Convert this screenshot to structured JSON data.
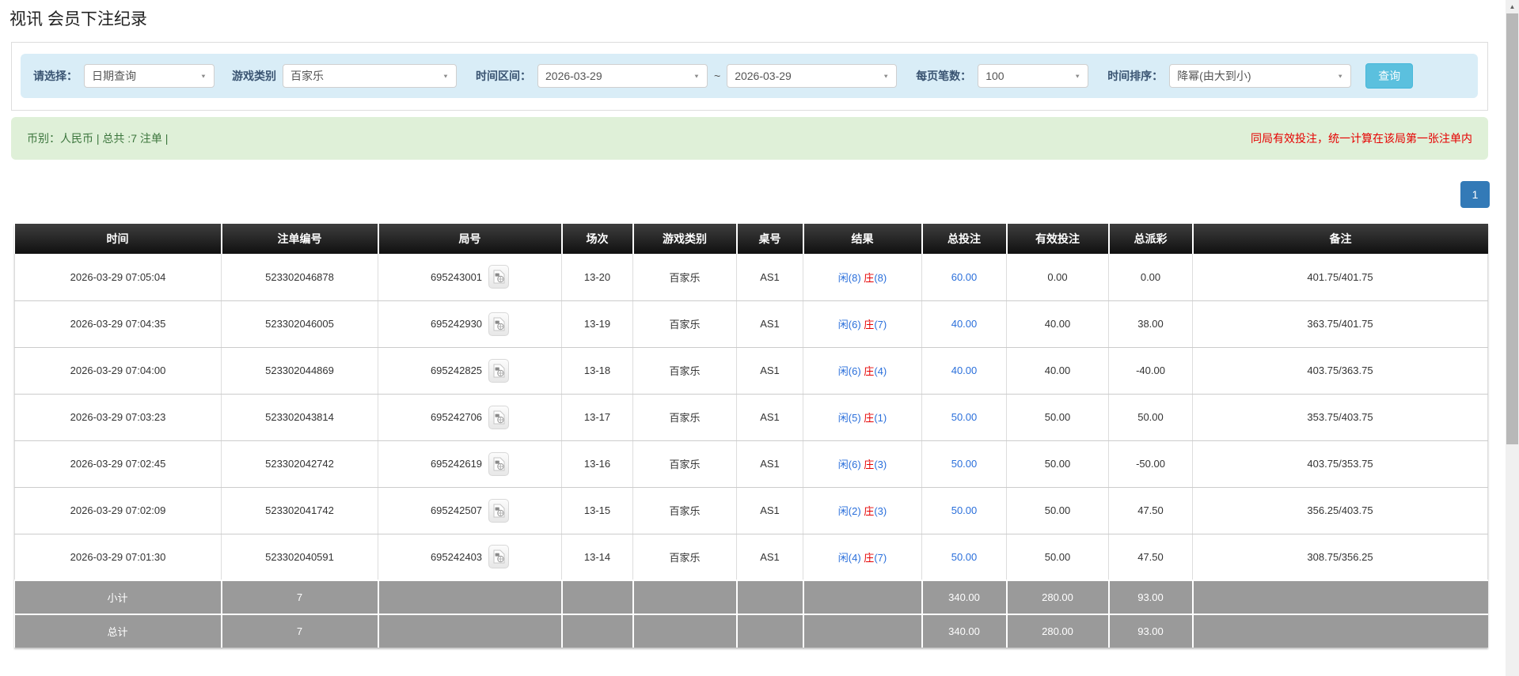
{
  "page": {
    "title": "视讯 会员下注纪录"
  },
  "filters": {
    "select_label": "请选择：",
    "select_value": "日期查询",
    "game_label": "游戏类别",
    "game_value": "百家乐",
    "range_label": "时间区间：",
    "date_from": "2026-03-29",
    "tilde": "~",
    "date_to": "2026-03-29",
    "per_page_label": "每页笔数：",
    "per_page_value": "100",
    "sort_label": "时间排序：",
    "sort_value": "降幂(由大到小)",
    "search_button": "查询"
  },
  "summary": {
    "currency_info": "币别：人民币 | 总共 :7 注单 |",
    "notice": "同局有效投注，统一计算在该局第一张注单内"
  },
  "pagination": {
    "page": "1"
  },
  "icons": {
    "chevron_down": "▼",
    "chevron_up": "▲"
  },
  "colors": {
    "link_blue": "#2a6fdb",
    "negative_red": "#e60000",
    "header_dark": "#101010",
    "footer_gray": "#9a9a9a",
    "panel_blue": "#d9edf7",
    "panel_green": "#dff0d8",
    "button_blue": "#5bc0de",
    "page_button_blue": "#337ab7"
  },
  "table": {
    "headers": [
      "时间",
      "注单编号",
      "局号",
      "场次",
      "游戏类别",
      "桌号",
      "结果",
      "总投注",
      "有效投注",
      "总派彩",
      "备注"
    ],
    "rows": [
      {
        "time": "2026-03-29 07:05:04",
        "bet_id": "523302046878",
        "round_no": "695243001",
        "session": "13-20",
        "game": "百家乐",
        "table_no": "AS1",
        "result_xian": "闲(8)",
        "result_zhuang": "庄",
        "result_zhuang_n": "(8)",
        "total_bet": "60.00",
        "valid_bet": "0.00",
        "payout": "0.00",
        "remark": "401.75/401.75"
      },
      {
        "time": "2026-03-29 07:04:35",
        "bet_id": "523302046005",
        "round_no": "695242930",
        "session": "13-19",
        "game": "百家乐",
        "table_no": "AS1",
        "result_xian": "闲(6)",
        "result_zhuang": "庄",
        "result_zhuang_n": "(7)",
        "total_bet": "40.00",
        "valid_bet": "40.00",
        "payout": "38.00",
        "remark": "363.75/401.75"
      },
      {
        "time": "2026-03-29 07:04:00",
        "bet_id": "523302044869",
        "round_no": "695242825",
        "session": "13-18",
        "game": "百家乐",
        "table_no": "AS1",
        "result_xian": "闲(6)",
        "result_zhuang": "庄",
        "result_zhuang_n": "(4)",
        "total_bet": "40.00",
        "valid_bet": "40.00",
        "payout": "-40.00",
        "remark": "403.75/363.75"
      },
      {
        "time": "2026-03-29 07:03:23",
        "bet_id": "523302043814",
        "round_no": "695242706",
        "session": "13-17",
        "game": "百家乐",
        "table_no": "AS1",
        "result_xian": "闲(5)",
        "result_zhuang": "庄",
        "result_zhuang_n": "(1)",
        "total_bet": "50.00",
        "valid_bet": "50.00",
        "payout": "50.00",
        "remark": "353.75/403.75"
      },
      {
        "time": "2026-03-29 07:02:45",
        "bet_id": "523302042742",
        "round_no": "695242619",
        "session": "13-16",
        "game": "百家乐",
        "table_no": "AS1",
        "result_xian": "闲(6)",
        "result_zhuang": "庄",
        "result_zhuang_n": "(3)",
        "total_bet": "50.00",
        "valid_bet": "50.00",
        "payout": "-50.00",
        "remark": "403.75/353.75"
      },
      {
        "time": "2026-03-29 07:02:09",
        "bet_id": "523302041742",
        "round_no": "695242507",
        "session": "13-15",
        "game": "百家乐",
        "table_no": "AS1",
        "result_xian": "闲(2)",
        "result_zhuang": "庄",
        "result_zhuang_n": "(3)",
        "total_bet": "50.00",
        "valid_bet": "50.00",
        "payout": "47.50",
        "remark": "356.25/403.75"
      },
      {
        "time": "2026-03-29 07:01:30",
        "bet_id": "523302040591",
        "round_no": "695242403",
        "session": "13-14",
        "game": "百家乐",
        "table_no": "AS1",
        "result_xian": "闲(4)",
        "result_zhuang": "庄",
        "result_zhuang_n": "(7)",
        "total_bet": "50.00",
        "valid_bet": "50.00",
        "payout": "47.50",
        "remark": "308.75/356.25"
      }
    ],
    "subtotal": {
      "label": "小计",
      "count": "7",
      "total_bet": "340.00",
      "valid_bet": "280.00",
      "payout": "93.00"
    },
    "total": {
      "label": "总计",
      "count": "7",
      "total_bet": "340.00",
      "valid_bet": "280.00",
      "payout": "93.00"
    }
  }
}
